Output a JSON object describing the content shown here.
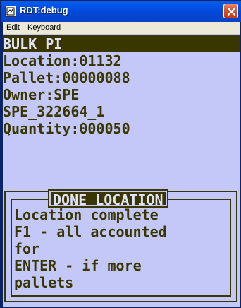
{
  "window": {
    "title": "RDT:debug"
  },
  "menu": {
    "items": [
      "Edit",
      "Keyboard"
    ]
  },
  "screen": {
    "header": "BULK PI",
    "lines": [
      "Location:01132",
      "Pallet:00000088",
      "Owner:SPE",
      "SPE_322664_1",
      "Quantity:000050"
    ]
  },
  "dialog": {
    "title": "DONE LOCATION",
    "lines": [
      "Location complete",
      "F1 - all accounted",
      "for",
      "ENTER - if more",
      "pallets"
    ]
  },
  "colors": {
    "screen_bg": "#c4c8f8",
    "screen_fg": "#3a3600"
  }
}
